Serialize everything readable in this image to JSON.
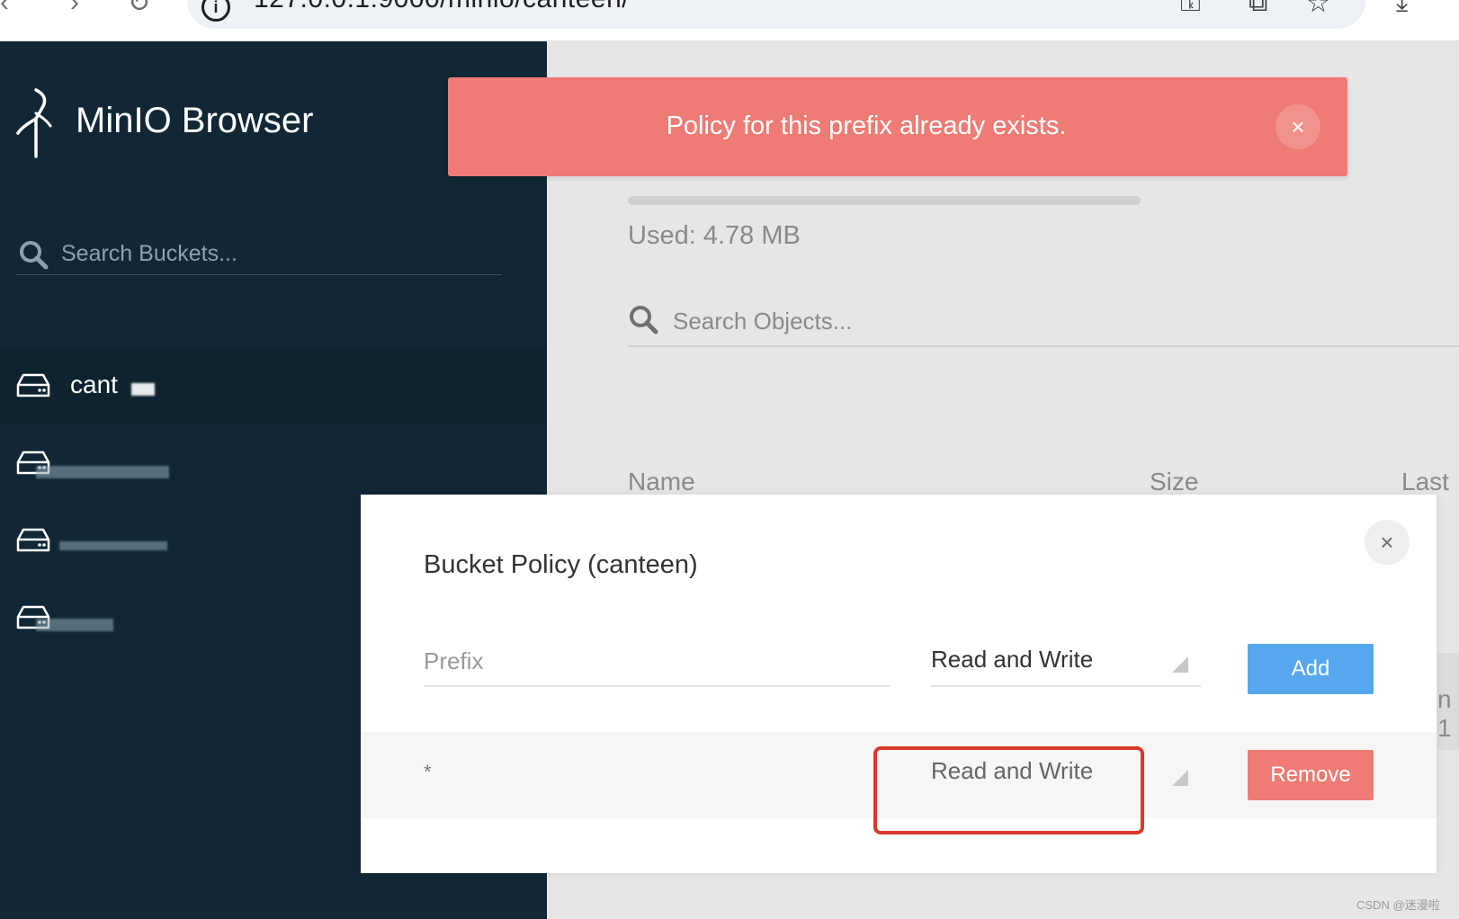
{
  "browser": {
    "url": "127.0.0.1:9000/minio/canteen/"
  },
  "sidebar": {
    "brand": "MinIO Browser",
    "search_placeholder": "Search Buckets...",
    "buckets": [
      {
        "name": "cant",
        "active": true
      },
      {
        "name": "",
        "active": false
      },
      {
        "name": "",
        "active": false
      },
      {
        "name": "",
        "active": false
      }
    ]
  },
  "main": {
    "used": "Used: 4.78 MB",
    "search_placeholder": "Search Objects...",
    "columns": [
      "Name",
      "Size",
      "Last"
    ],
    "row_peek": "n 1"
  },
  "toast": {
    "message": "Policy for this prefix already exists.",
    "close_glyph": "×",
    "color": "#ee7b74"
  },
  "modal": {
    "title": "Bucket Policy (canteen)",
    "close_glyph": "×",
    "prefix_placeholder": "Prefix",
    "new_policy_value": "Read and Write",
    "add_label": "Add",
    "policies": [
      {
        "prefix": "*",
        "policy": "Read and Write",
        "remove_label": "Remove"
      }
    ]
  },
  "colors": {
    "sidebar_bg": "#112735",
    "add_button": "#56a7ed",
    "remove_button": "#ee7b74",
    "highlight": "#d93a2b"
  },
  "watermark": "CSDN @迷漫啦"
}
